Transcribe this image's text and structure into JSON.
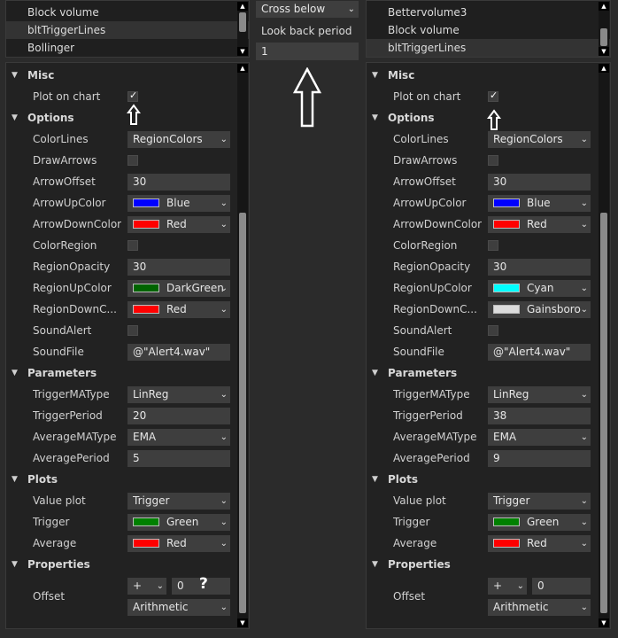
{
  "left_list": {
    "items": [
      {
        "label": "Block volume"
      },
      {
        "label": "bltTriggerLines",
        "selected": true
      },
      {
        "label": "Bollinger"
      }
    ]
  },
  "right_list": {
    "items": [
      {
        "label": "Bettervolume3"
      },
      {
        "label": "Block volume"
      },
      {
        "label": "bltTriggerLines",
        "selected": true
      }
    ]
  },
  "middle": {
    "condition": "Cross below",
    "lookback_label": "Look back period",
    "lookback_value": "1"
  },
  "left_grid": {
    "misc": "Misc",
    "plot_on_chart": "Plot on chart",
    "options": "Options",
    "color_lines": {
      "label": "ColorLines",
      "value": "RegionColors"
    },
    "draw_arrows": {
      "label": "DrawArrows"
    },
    "arrow_offset": {
      "label": "ArrowOffset",
      "value": "30"
    },
    "arrow_up_color": {
      "label": "ArrowUpColor",
      "value": "Blue",
      "color": "#0000ff"
    },
    "arrow_down_color": {
      "label": "ArrowDownColor",
      "value": "Red",
      "color": "#ff0000"
    },
    "color_region": {
      "label": "ColorRegion"
    },
    "region_opacity": {
      "label": "RegionOpacity",
      "value": "30"
    },
    "region_up_color": {
      "label": "RegionUpColor",
      "value": "DarkGreen",
      "color": "#006400"
    },
    "region_down_color": {
      "label": "RegionDownC...",
      "value": "Red",
      "color": "#ff0000"
    },
    "sound_alert": {
      "label": "SoundAlert"
    },
    "sound_file": {
      "label": "SoundFile",
      "value": "@\"Alert4.wav\""
    },
    "parameters": "Parameters",
    "trigger_ma_type": {
      "label": "TriggerMAType",
      "value": "LinReg"
    },
    "trigger_period": {
      "label": "TriggerPeriod",
      "value": "20"
    },
    "average_ma_type": {
      "label": "AverageMAType",
      "value": "EMA"
    },
    "average_period": {
      "label": "AveragePeriod",
      "value": "5"
    },
    "plots": "Plots",
    "value_plot": {
      "label": "Value plot",
      "value": "Trigger"
    },
    "trigger": {
      "label": "Trigger",
      "value": "Green",
      "color": "#008000"
    },
    "average": {
      "label": "Average",
      "value": "Red",
      "color": "#ff0000"
    },
    "properties": "Properties",
    "offset": {
      "label": "Offset",
      "op": "+",
      "num": "0",
      "mode": "Arithmetic"
    },
    "question": "?"
  },
  "right_grid": {
    "misc": "Misc",
    "plot_on_chart": "Plot on chart",
    "options": "Options",
    "color_lines": {
      "label": "ColorLines",
      "value": "RegionColors"
    },
    "draw_arrows": {
      "label": "DrawArrows"
    },
    "arrow_offset": {
      "label": "ArrowOffset",
      "value": "30"
    },
    "arrow_up_color": {
      "label": "ArrowUpColor",
      "value": "Blue",
      "color": "#0000ff"
    },
    "arrow_down_color": {
      "label": "ArrowDownColor",
      "value": "Red",
      "color": "#ff0000"
    },
    "color_region": {
      "label": "ColorRegion"
    },
    "region_opacity": {
      "label": "RegionOpacity",
      "value": "30"
    },
    "region_up_color": {
      "label": "RegionUpColor",
      "value": "Cyan",
      "color": "#00ffff"
    },
    "region_down_color": {
      "label": "RegionDownC...",
      "value": "Gainsboro",
      "color": "#dcdcdc"
    },
    "sound_alert": {
      "label": "SoundAlert"
    },
    "sound_file": {
      "label": "SoundFile",
      "value": "@\"Alert4.wav\""
    },
    "parameters": "Parameters",
    "trigger_ma_type": {
      "label": "TriggerMAType",
      "value": "LinReg"
    },
    "trigger_period": {
      "label": "TriggerPeriod",
      "value": "38"
    },
    "average_ma_type": {
      "label": "AverageMAType",
      "value": "EMA"
    },
    "average_period": {
      "label": "AveragePeriod",
      "value": "9"
    },
    "plots": "Plots",
    "value_plot": {
      "label": "Value plot",
      "value": "Trigger"
    },
    "trigger": {
      "label": "Trigger",
      "value": "Green",
      "color": "#008000"
    },
    "average": {
      "label": "Average",
      "value": "Red",
      "color": "#ff0000"
    },
    "properties": "Properties",
    "offset": {
      "label": "Offset",
      "op": "+",
      "num": "0",
      "mode": "Arithmetic"
    }
  },
  "icons": {
    "collapse": "triangle-down-icon",
    "dropdown": "chevron-down-icon",
    "annotation": "up-arrow-icon"
  }
}
